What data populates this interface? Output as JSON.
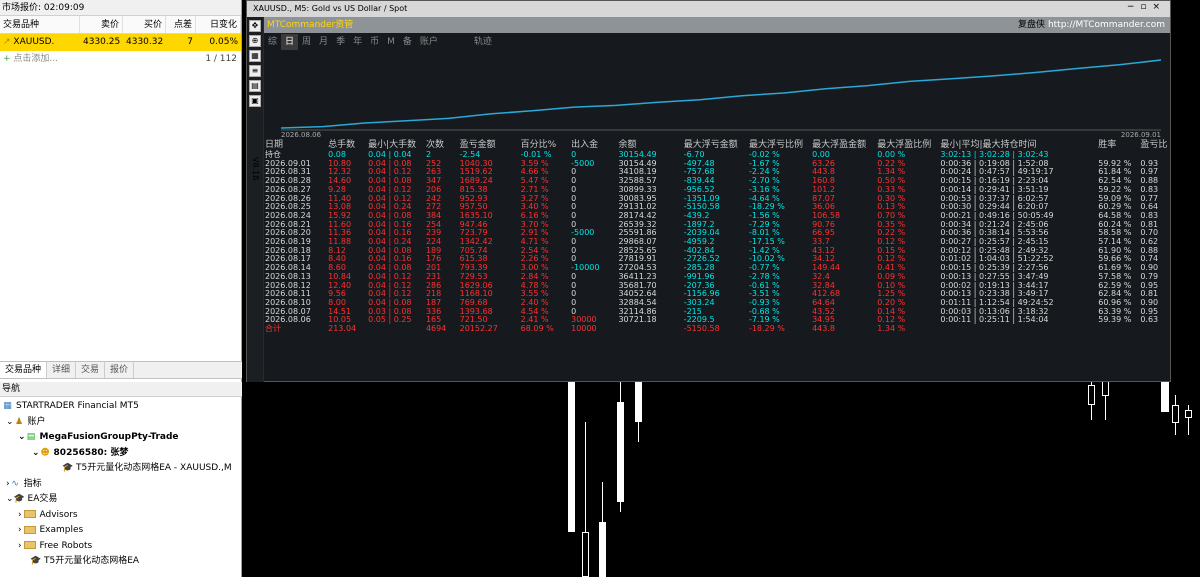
{
  "left_panel": {
    "title": "市场报价: 02:09:09",
    "headers": [
      "交易品种",
      "卖价",
      "买价",
      "点差",
      "日变化"
    ],
    "row": [
      "XAUUSD.",
      "4330.25",
      "4330.32",
      "7",
      "0.05%"
    ],
    "add": "点击添加...",
    "count": "1 / 112",
    "tabs": [
      "交易品种",
      "详细",
      "交易",
      "报价"
    ]
  },
  "navigator": {
    "title": "导航",
    "items": [
      "STARTRADER Financial MT5",
      "账户",
      "MegaFusionGroupPty-Trade",
      "80256580: 张梦",
      "T5开元量化动态网格EA - XAUUSD.,M",
      "指标",
      "EA交易",
      "Advisors",
      "Examples",
      "Free Robots",
      "T5开元量化动态网格EA"
    ]
  },
  "window": {
    "title": "XAUUSD., M5:  Gold vs US Dollar / Spot",
    "app": "MTCommander资管",
    "right1": "复盘侠",
    "right2": "http://MTCommander.com",
    "tabs": [
      "综",
      "日",
      "周",
      "月",
      "季",
      "年",
      "币",
      "M",
      "备",
      "账户",
      "轨迹"
    ],
    "vlabel": "V8.18"
  },
  "chart_data": {
    "type": "area",
    "x": [
      "2026.08.06",
      "2026.09.01"
    ],
    "start_date": "2026.08.06",
    "end_date": "2026.09.01",
    "balance": [
      20569.0,
      20721.0,
      21104,
      21338,
      21596,
      22076,
      22415,
      22799,
      22979,
      23305,
      23580,
      24018,
      24298,
      24747,
      25087,
      25536,
      25830,
      26126,
      26483,
      26913,
      27304,
      27821
    ],
    "curve_note": "rising equity line",
    "ylim": [
      0,
      1
    ]
  },
  "table": {
    "headers": [
      "日期",
      "总手数",
      "最小|大手数",
      "次数",
      "盈亏金额",
      "百分比%",
      "出入金",
      "余额",
      "最大浮亏金额",
      "最大浮亏比例",
      "最大浮盈金额",
      "最大浮盈比例",
      "最小|平均|最大持仓时间",
      "胜率",
      "盈亏比"
    ],
    "hold": [
      "持仓",
      "0.08",
      "0.04 | 0.04",
      "2",
      "-2.54",
      "-0.01 %",
      "0",
      "30154.49",
      "-6.70",
      "-0.02 %",
      "0.00",
      "0.00 %",
      "3:02:13 | 3:02:28 | 3:02:43",
      "",
      ""
    ],
    "rows": [
      [
        "2026.09.01",
        "10.80",
        "0.04 | 0.08",
        "252",
        "1040.30",
        "3.59 %",
        "-5000",
        "30154.49",
        "-497.48",
        "-1.67 %",
        "63.26",
        "0.22 %",
        "0:00:36 | 0:19:08 | 1:52:08",
        "59.92 %",
        "0.93"
      ],
      [
        "2026.08.31",
        "12.32",
        "0.04 | 0.12",
        "263",
        "1519.62",
        "4.66 %",
        "0",
        "34108.19",
        "-757.68",
        "-2.24 %",
        "443.8",
        "1.34 %",
        "0:00:24 | 0:47:57 | 49:19:17",
        "61.84 %",
        "0.97"
      ],
      [
        "2026.08.28",
        "14.60",
        "0.04 | 0.08",
        "347",
        "1689.24",
        "5.47 %",
        "0",
        "32588.57",
        "-839.44",
        "-2.70 %",
        "160.8",
        "0.50 %",
        "0:00:15 | 0:16:19 | 2:23:04",
        "62.54 %",
        "0.88"
      ],
      [
        "2026.08.27",
        "9.28",
        "0.04 | 0.12",
        "206",
        "815.38",
        "2.71 %",
        "0",
        "30899.33",
        "-956.52",
        "-3.16 %",
        "101.2",
        "0.33 %",
        "0:00:14 | 0:29:41 | 3:51:19",
        "59.22 %",
        "0.83"
      ],
      [
        "2026.08.26",
        "11.40",
        "0.04 | 0.12",
        "242",
        "952.93",
        "3.27 %",
        "0",
        "30083.95",
        "-1351.09",
        "-4.64 %",
        "87.07",
        "0.30 %",
        "0:00:53 | 0:37:37 | 6:02:57",
        "59.09 %",
        "0.77"
      ],
      [
        "2026.08.25",
        "13.08",
        "0.04 | 0.24",
        "272",
        "957.50",
        "3.40 %",
        "0",
        "29131.02",
        "-5150.58",
        "-18.29 %",
        "36.06",
        "0.13 %",
        "0:00:30 | 0:29:44 | 6:20:07",
        "60.29 %",
        "0.64"
      ],
      [
        "2026.08.24",
        "15.92",
        "0.04 | 0.08",
        "384",
        "1635.10",
        "6.16 %",
        "0",
        "28174.42",
        "-439.2",
        "-1.56 %",
        "106.58",
        "0.70 %",
        "0:00:21 | 0:49:16 | 50:05:49",
        "64.58 %",
        "0.83"
      ],
      [
        "2026.08.21",
        "11.60",
        "0.04 | 0.16",
        "254",
        "947.46",
        "3.70 %",
        "0",
        "26539.32",
        "-1897.2",
        "-7.29 %",
        "90.76",
        "0.35 %",
        "0:00:34 | 0:21:24 | 2:45:06",
        "60.24 %",
        "0.81"
      ],
      [
        "2026.08.20",
        "11.36",
        "0.04 | 0.16",
        "239",
        "723.79",
        "2.91 %",
        "-5000",
        "25591.86",
        "-2039.04",
        "-8.01 %",
        "66.95",
        "0.22 %",
        "0:00:36 | 0:38:14 | 5:53:56",
        "58.58 %",
        "0.70"
      ],
      [
        "2026.08.19",
        "11.88",
        "0.04 | 0.24",
        "224",
        "1342.42",
        "4.71 %",
        "0",
        "29868.07",
        "-4959.2",
        "-17.15 %",
        "33.7",
        "0.12 %",
        "0:00:27 | 0:25:57 | 2:45:15",
        "57.14 %",
        "0.62"
      ],
      [
        "2026.08.18",
        "8.12",
        "0.04 | 0.08",
        "189",
        "705.74",
        "2.54 %",
        "0",
        "28525.65",
        "-402.84",
        "-1.42 %",
        "43.12",
        "0.15 %",
        "0:00:12 | 0:25:48 | 2:49:32",
        "61.90 %",
        "0.88"
      ],
      [
        "2026.08.17",
        "8.40",
        "0.04 | 0.16",
        "176",
        "615.38",
        "2.26 %",
        "0",
        "27819.91",
        "-2726.52",
        "-10.02 %",
        "34.12",
        "0.12 %",
        "0:01:02 | 1:04:03 | 51:22:52",
        "59.66 %",
        "0.74"
      ],
      [
        "2026.08.14",
        "8.60",
        "0.04 | 0.08",
        "201",
        "793.39",
        "3.00 %",
        "-10000",
        "27204.53",
        "-285.28",
        "-0.77 %",
        "149.44",
        "0.41 %",
        "0:00:15 | 0:25:39 | 2:27:56",
        "61.69 %",
        "0.90"
      ],
      [
        "2026.08.13",
        "10.84",
        "0.04 | 0.12",
        "231",
        "729.53",
        "2.84 %",
        "0",
        "36411.23",
        "-991.96",
        "-2.78 %",
        "32.4",
        "0.09 %",
        "0:00:13 | 0:27:55 | 3:47:49",
        "57.58 %",
        "0.79"
      ],
      [
        "2026.08.12",
        "12.40",
        "0.04 | 0.12",
        "286",
        "1629.06",
        "4.78 %",
        "0",
        "35681.70",
        "-207.36",
        "-0.61 %",
        "32.84",
        "0.10 %",
        "0:00:02 | 0:19:13 | 3:44:17",
        "62.59 %",
        "0.95"
      ],
      [
        "2026.08.11",
        "9.56",
        "0.04 | 0.12",
        "218",
        "1168.10",
        "3.55 %",
        "0",
        "34052.64",
        "-1156.96",
        "-3.51 %",
        "412.68",
        "1.25 %",
        "0:00:13 | 0:23:38 | 3:49:17",
        "62.84 %",
        "0.81"
      ],
      [
        "2026.08.10",
        "8.00",
        "0.04 | 0.08",
        "187",
        "769.68",
        "2.40 %",
        "0",
        "32884.54",
        "-303.24",
        "-0.93 %",
        "64.64",
        "0.20 %",
        "0:01:11 | 1:12:54 | 49:24:52",
        "60.96 %",
        "0.90"
      ],
      [
        "2026.08.07",
        "14.51",
        "0.03 | 0.08",
        "336",
        "1393.68",
        "4.54 %",
        "0",
        "32114.86",
        "-215",
        "-0.68 %",
        "43.52",
        "0.14 %",
        "0:00:03 | 0:13:06 | 3:18:32",
        "63.39 %",
        "0.95"
      ],
      [
        "2026.08.06",
        "10.05",
        "0.05 | 0.25",
        "165",
        "721.50",
        "2.41 %",
        "30000",
        "30721.18",
        "-2209.5",
        "-7.19 %",
        "34.95",
        "0.12 %",
        "0:00:11 | 0:25:11 | 1:54:04",
        "59.39 %",
        "0.63"
      ]
    ],
    "total": [
      "合计",
      "213.04",
      "",
      "4694",
      "20152.27",
      "68.09 %",
      "10000",
      "",
      "-5150.58",
      "-18.29 %",
      "443.8",
      "1.34 %",
      "",
      "",
      ""
    ]
  },
  "colors": {
    "accent": "#ffd700",
    "red": "#ff3030",
    "cyan": "#00e5e5",
    "line": "#2aa8d8"
  }
}
